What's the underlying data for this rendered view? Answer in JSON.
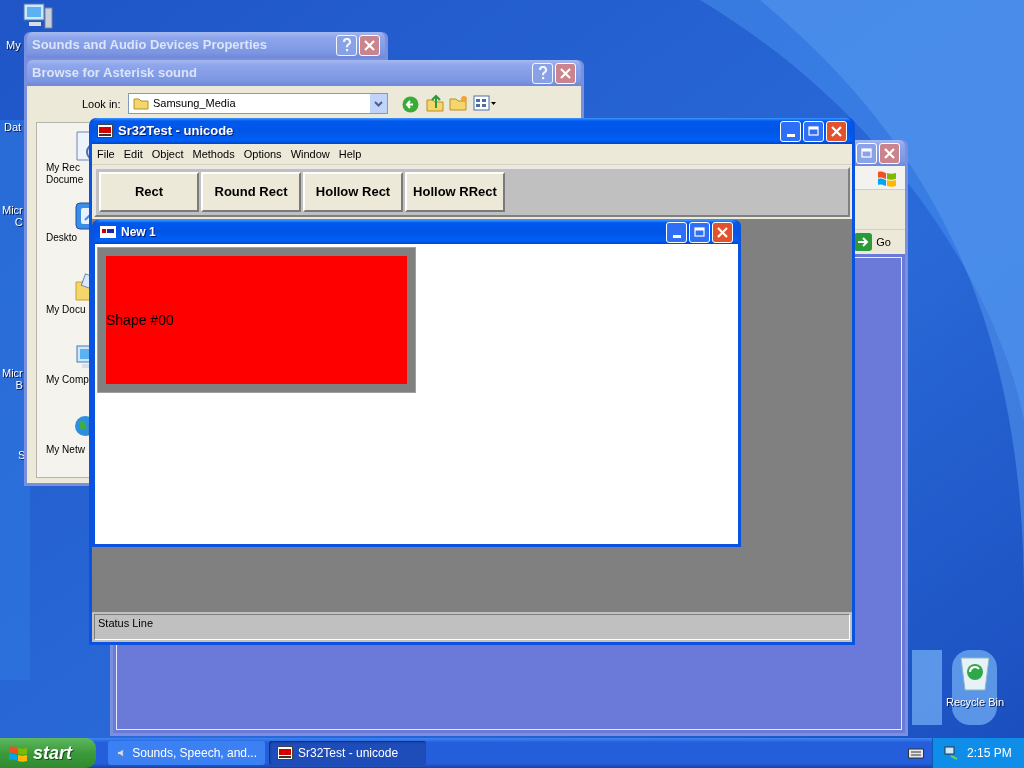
{
  "desktop_icons": [
    {
      "lines": [
        "My"
      ]
    },
    {
      "lines": [
        "Dat"
      ]
    },
    {
      "lines": [
        "Micr",
        "C"
      ]
    },
    {
      "lines": [
        "Micr",
        "B"
      ]
    },
    {
      "lines": [
        "S"
      ]
    }
  ],
  "sounds_window": {
    "title": "Sounds and Audio Devices Properties",
    "active": false
  },
  "browse_window": {
    "title": "Browse for Asterisk sound",
    "active": false,
    "look_in_label": "Look in:",
    "look_in_value": "Samsung_Media",
    "places": [
      {
        "kind": "recent",
        "lines": [
          "My Rec",
          "Docume"
        ]
      },
      {
        "kind": "desktop",
        "lines": [
          "Deskto"
        ]
      },
      {
        "kind": "documents",
        "lines": [
          "My Docu"
        ]
      },
      {
        "kind": "computer",
        "lines": [
          "My Comp"
        ]
      },
      {
        "kind": "network",
        "lines": [
          "My Netw"
        ]
      }
    ]
  },
  "back_window": {
    "active": false,
    "go_button": "Go"
  },
  "app_window": {
    "title": "Sr32Test - unicode",
    "active": true,
    "menu": [
      "File",
      "Edit",
      "Object",
      "Methods",
      "Options",
      "Window",
      "Help"
    ],
    "toolbar": [
      "Rect",
      "Round Rect",
      "Hollow Rect",
      "Hollow RRect"
    ],
    "status": "Status Line"
  },
  "child_window": {
    "title": "New 1",
    "active": true,
    "shapes": [
      {
        "label": "Shape #00"
      }
    ]
  },
  "recycle_bin": {
    "label": "Recycle Bin"
  },
  "taskbar": {
    "start": "start",
    "tasks": [
      {
        "label": "Sounds, Speech, and...",
        "selected": false
      },
      {
        "label": "Sr32Test - unicode",
        "selected": true
      }
    ],
    "clock": "2:15 PM"
  }
}
